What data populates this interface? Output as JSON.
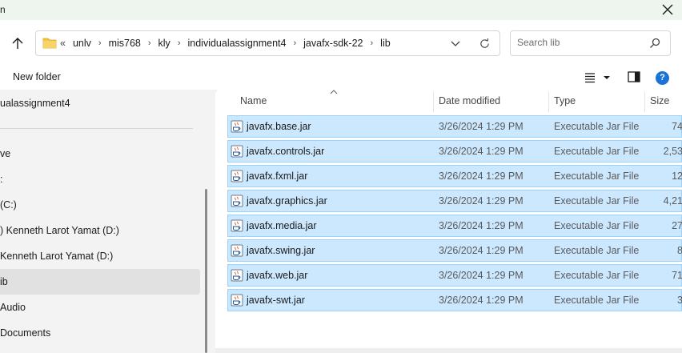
{
  "window": {
    "title_fragment": "n"
  },
  "navigation": {
    "breadcrumb_lead": "«",
    "breadcrumbs": [
      "unlv",
      "mis768",
      "kly",
      "individualassignment4",
      "javafx-sdk-22",
      "lib"
    ],
    "separator": "›"
  },
  "search": {
    "placeholder": "Search lib"
  },
  "toolbar": {
    "new_folder_label": "New folder",
    "help_glyph": "?"
  },
  "sidebar": {
    "items": [
      {
        "label": "ualassignment4",
        "selected": false
      },
      {
        "label": "ve",
        "selected": false
      },
      {
        "label": ":",
        "selected": false
      },
      {
        "label": "(C:)",
        "selected": false
      },
      {
        "label": ") Kenneth Larot Yamat  (D:)",
        "selected": false
      },
      {
        "label": "Kenneth Larot Yamat  (D:)",
        "selected": false
      },
      {
        "label": "ib",
        "selected": true
      },
      {
        "label": " Audio",
        "selected": false
      },
      {
        "label": " Documents",
        "selected": false
      }
    ]
  },
  "file_list": {
    "columns": {
      "name": "Name",
      "date_modified": "Date modified",
      "type": "Type",
      "size": "Size"
    },
    "files": [
      {
        "name": "javafx.base.jar",
        "date": "3/26/2024 1:29 PM",
        "type": "Executable Jar File",
        "size": "74"
      },
      {
        "name": "javafx.controls.jar",
        "date": "3/26/2024 1:29 PM",
        "type": "Executable Jar File",
        "size": "2,53"
      },
      {
        "name": "javafx.fxml.jar",
        "date": "3/26/2024 1:29 PM",
        "type": "Executable Jar File",
        "size": "12"
      },
      {
        "name": "javafx.graphics.jar",
        "date": "3/26/2024 1:29 PM",
        "type": "Executable Jar File",
        "size": "4,21"
      },
      {
        "name": "javafx.media.jar",
        "date": "3/26/2024 1:29 PM",
        "type": "Executable Jar File",
        "size": "27"
      },
      {
        "name": "javafx.swing.jar",
        "date": "3/26/2024 1:29 PM",
        "type": "Executable Jar File",
        "size": "8"
      },
      {
        "name": "javafx.web.jar",
        "date": "3/26/2024 1:29 PM",
        "type": "Executable Jar File",
        "size": "71"
      },
      {
        "name": "javafx-swt.jar",
        "date": "3/26/2024 1:29 PM",
        "type": "Executable Jar File",
        "size": "3"
      }
    ]
  },
  "colors": {
    "selection_fill": "#cce8ff",
    "selection_border": "#99d1ff",
    "accent": "#1b73d6",
    "folder": "#f3c443"
  },
  "icons": {
    "close": "close-icon",
    "up": "arrow-up-icon",
    "folder": "folder-icon",
    "dropdown": "chevron-down-icon",
    "refresh": "refresh-icon",
    "search": "search-icon",
    "view": "view-options-icon",
    "details_pane": "details-pane-icon",
    "help": "help-icon",
    "file": "jar-file-icon"
  }
}
